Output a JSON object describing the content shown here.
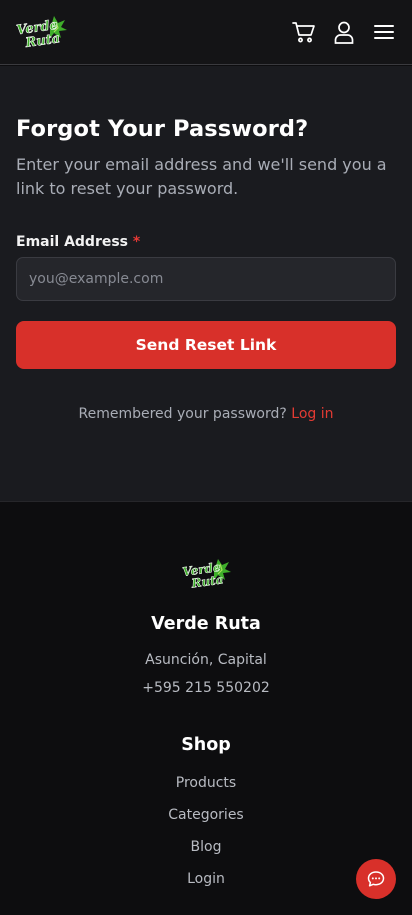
{
  "header": {
    "logo_text_1": "Verde",
    "logo_text_2": "Ruta",
    "icons": [
      "cart-icon",
      "user-icon",
      "menu-icon"
    ]
  },
  "form": {
    "title": "Forgot Your Password?",
    "subtitle": "Enter your email address and we'll send you a link to reset your password.",
    "email_label": "Email Address",
    "required_mark": "*",
    "email_placeholder": "you@example.com",
    "email_value": "",
    "submit_label": "Send Reset Link",
    "remember_text": "Remembered your password?",
    "login_link": "Log in"
  },
  "footer": {
    "brand": "Verde Ruta",
    "location": "Asunción, Capital",
    "phone": "+595 215 550202",
    "shop_heading": "Shop",
    "shop_links": [
      "Products",
      "Categories",
      "Blog",
      "Login"
    ]
  },
  "colors": {
    "accent": "#d8302a",
    "link": "#e33b33",
    "background": "#0d0d0f",
    "panel": "#1a1b1f",
    "logo_green": "#3fae2a"
  }
}
